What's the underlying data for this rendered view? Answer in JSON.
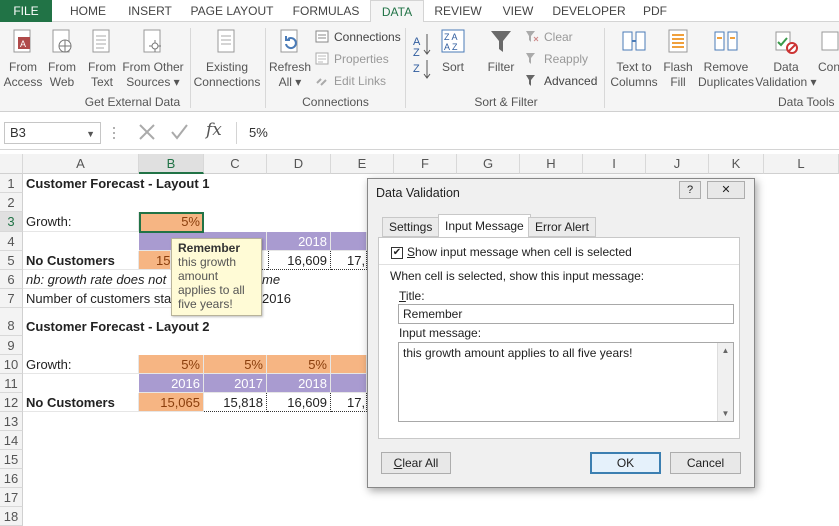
{
  "ribbon_tabs": [
    "FILE",
    "HOME",
    "INSERT",
    "PAGE LAYOUT",
    "FORMULAS",
    "DATA",
    "REVIEW",
    "VIEW",
    "DEVELOPER",
    "PDF"
  ],
  "active_tab": "DATA",
  "ribbon": {
    "get_external": {
      "from_access": [
        "From",
        "Access"
      ],
      "from_web": [
        "From",
        "Web"
      ],
      "from_text": [
        "From",
        "Text"
      ],
      "from_other": [
        "From Other",
        "Sources ▾"
      ],
      "existing": [
        "Existing",
        "Connections"
      ],
      "label": "Get External Data"
    },
    "connections": {
      "refresh": [
        "Refresh",
        "All ▾"
      ],
      "connections": "Connections",
      "properties": "Properties",
      "edit_links": "Edit Links",
      "label": "Connections"
    },
    "sort_filter": {
      "sort": "Sort",
      "filter": "Filter",
      "clear": "Clear",
      "reapply": "Reapply",
      "advanced": "Advanced",
      "label": "Sort & Filter"
    },
    "data_tools": {
      "text_to_columns": [
        "Text to",
        "Columns"
      ],
      "flash_fill": [
        "Flash",
        "Fill"
      ],
      "remove_duplicates": [
        "Remove",
        "Duplicates"
      ],
      "data_validation": [
        "Data",
        "Validation ▾"
      ],
      "consolidate": "Con",
      "label": "Data Tools"
    }
  },
  "formula_bar": {
    "name_box": "B3",
    "value": "5%",
    "fx": "fx"
  },
  "columns": [
    "A",
    "B",
    "C",
    "D",
    "E",
    "F",
    "G",
    "H",
    "I",
    "J",
    "K",
    "L"
  ],
  "rows": [
    "1",
    "2",
    "3",
    "4",
    "5",
    "6",
    "7",
    "8",
    "9",
    "10",
    "11",
    "12",
    "13",
    "14",
    "15",
    "16",
    "17",
    "18"
  ],
  "cells": {
    "A1": "Customer Forecast - Layout 1",
    "A3": "Growth:",
    "B3": "5%",
    "D4": "2018",
    "A5": "No Customers",
    "B5": "15",
    "D5": "16,609",
    "E5": "17,",
    "A6": "nb: growth rate does not",
    "A6b": "me",
    "A7": "Number of customers sta",
    "A7b": "2016",
    "A8": "Customer Forecast - Layout 2",
    "A10": "Growth:",
    "B10": "5%",
    "C10": "5%",
    "D10": "5%",
    "B11": "2016",
    "C11": "2017",
    "D11": "2018",
    "A12": "No Customers",
    "B12": "15,065",
    "C12": "15,818",
    "D12": "16,609",
    "E12": "17,"
  },
  "tooltip": {
    "title": "Remember",
    "body": "this growth amount applies to all five years!"
  },
  "dialog": {
    "title": "Data Validation",
    "help": "?",
    "close": "✕",
    "tabs": [
      "Settings",
      "Input Message",
      "Error Alert"
    ],
    "active_tab": "Input Message",
    "show_checkbox_label": "Show input message when cell is selected",
    "show_checked": true,
    "instruction": "When cell is selected, show this input message:",
    "title_label": "Title:",
    "title_value": "Remember",
    "message_label": "Input message:",
    "message_value": "this growth amount applies to all five years!",
    "clear_all": "Clear All",
    "ok": "OK",
    "cancel": "Cancel"
  }
}
